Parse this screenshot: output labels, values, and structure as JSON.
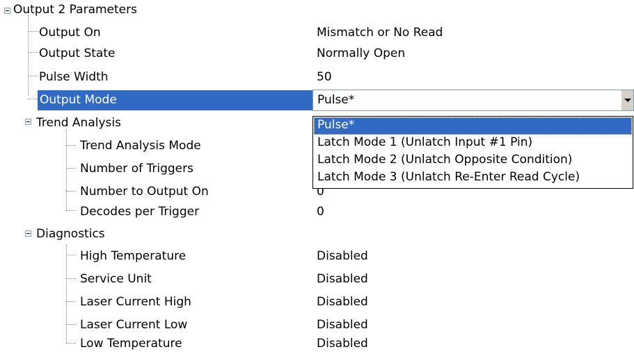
{
  "tree": {
    "root": {
      "label": "Output 2 Parameters"
    },
    "output_on": {
      "label": "Output On",
      "value": "Mismatch or No Read"
    },
    "output_state": {
      "label": "Output State",
      "value": "Normally Open"
    },
    "pulse_width": {
      "label": "Pulse Width",
      "value": "50"
    },
    "output_mode": {
      "label": "Output Mode",
      "value": "Pulse*"
    },
    "trend_analysis": {
      "label": "Trend Analysis",
      "mode": {
        "label": "Trend Analysis Mode",
        "value": ""
      },
      "triggers": {
        "label": "Number of Triggers",
        "value": ""
      },
      "output_on_count": {
        "label": "Number to Output On",
        "value": "0"
      },
      "decodes": {
        "label": "Decodes per Trigger",
        "value": "0"
      }
    },
    "diagnostics": {
      "label": "Diagnostics",
      "high_temp": {
        "label": "High Temperature",
        "value": "Disabled"
      },
      "service_unit": {
        "label": "Service Unit",
        "value": "Disabled"
      },
      "laser_high": {
        "label": "Laser Current High",
        "value": "Disabled"
      },
      "laser_low": {
        "label": "Laser Current Low",
        "value": "Disabled"
      },
      "low_temp": {
        "label": "Low Temperature",
        "value": "Disabled"
      }
    }
  },
  "dropdown": {
    "options": [
      "Pulse*",
      "Latch Mode 1 (Unlatch Input #1 Pin)",
      "Latch Mode 2 (Unlatch Opposite Condition)",
      "Latch Mode 3 (Unlatch Re-Enter Read Cycle)"
    ],
    "selected_index": 0
  },
  "colors": {
    "selection": "#316ac5",
    "tree_lines": "#8a8a8a"
  }
}
